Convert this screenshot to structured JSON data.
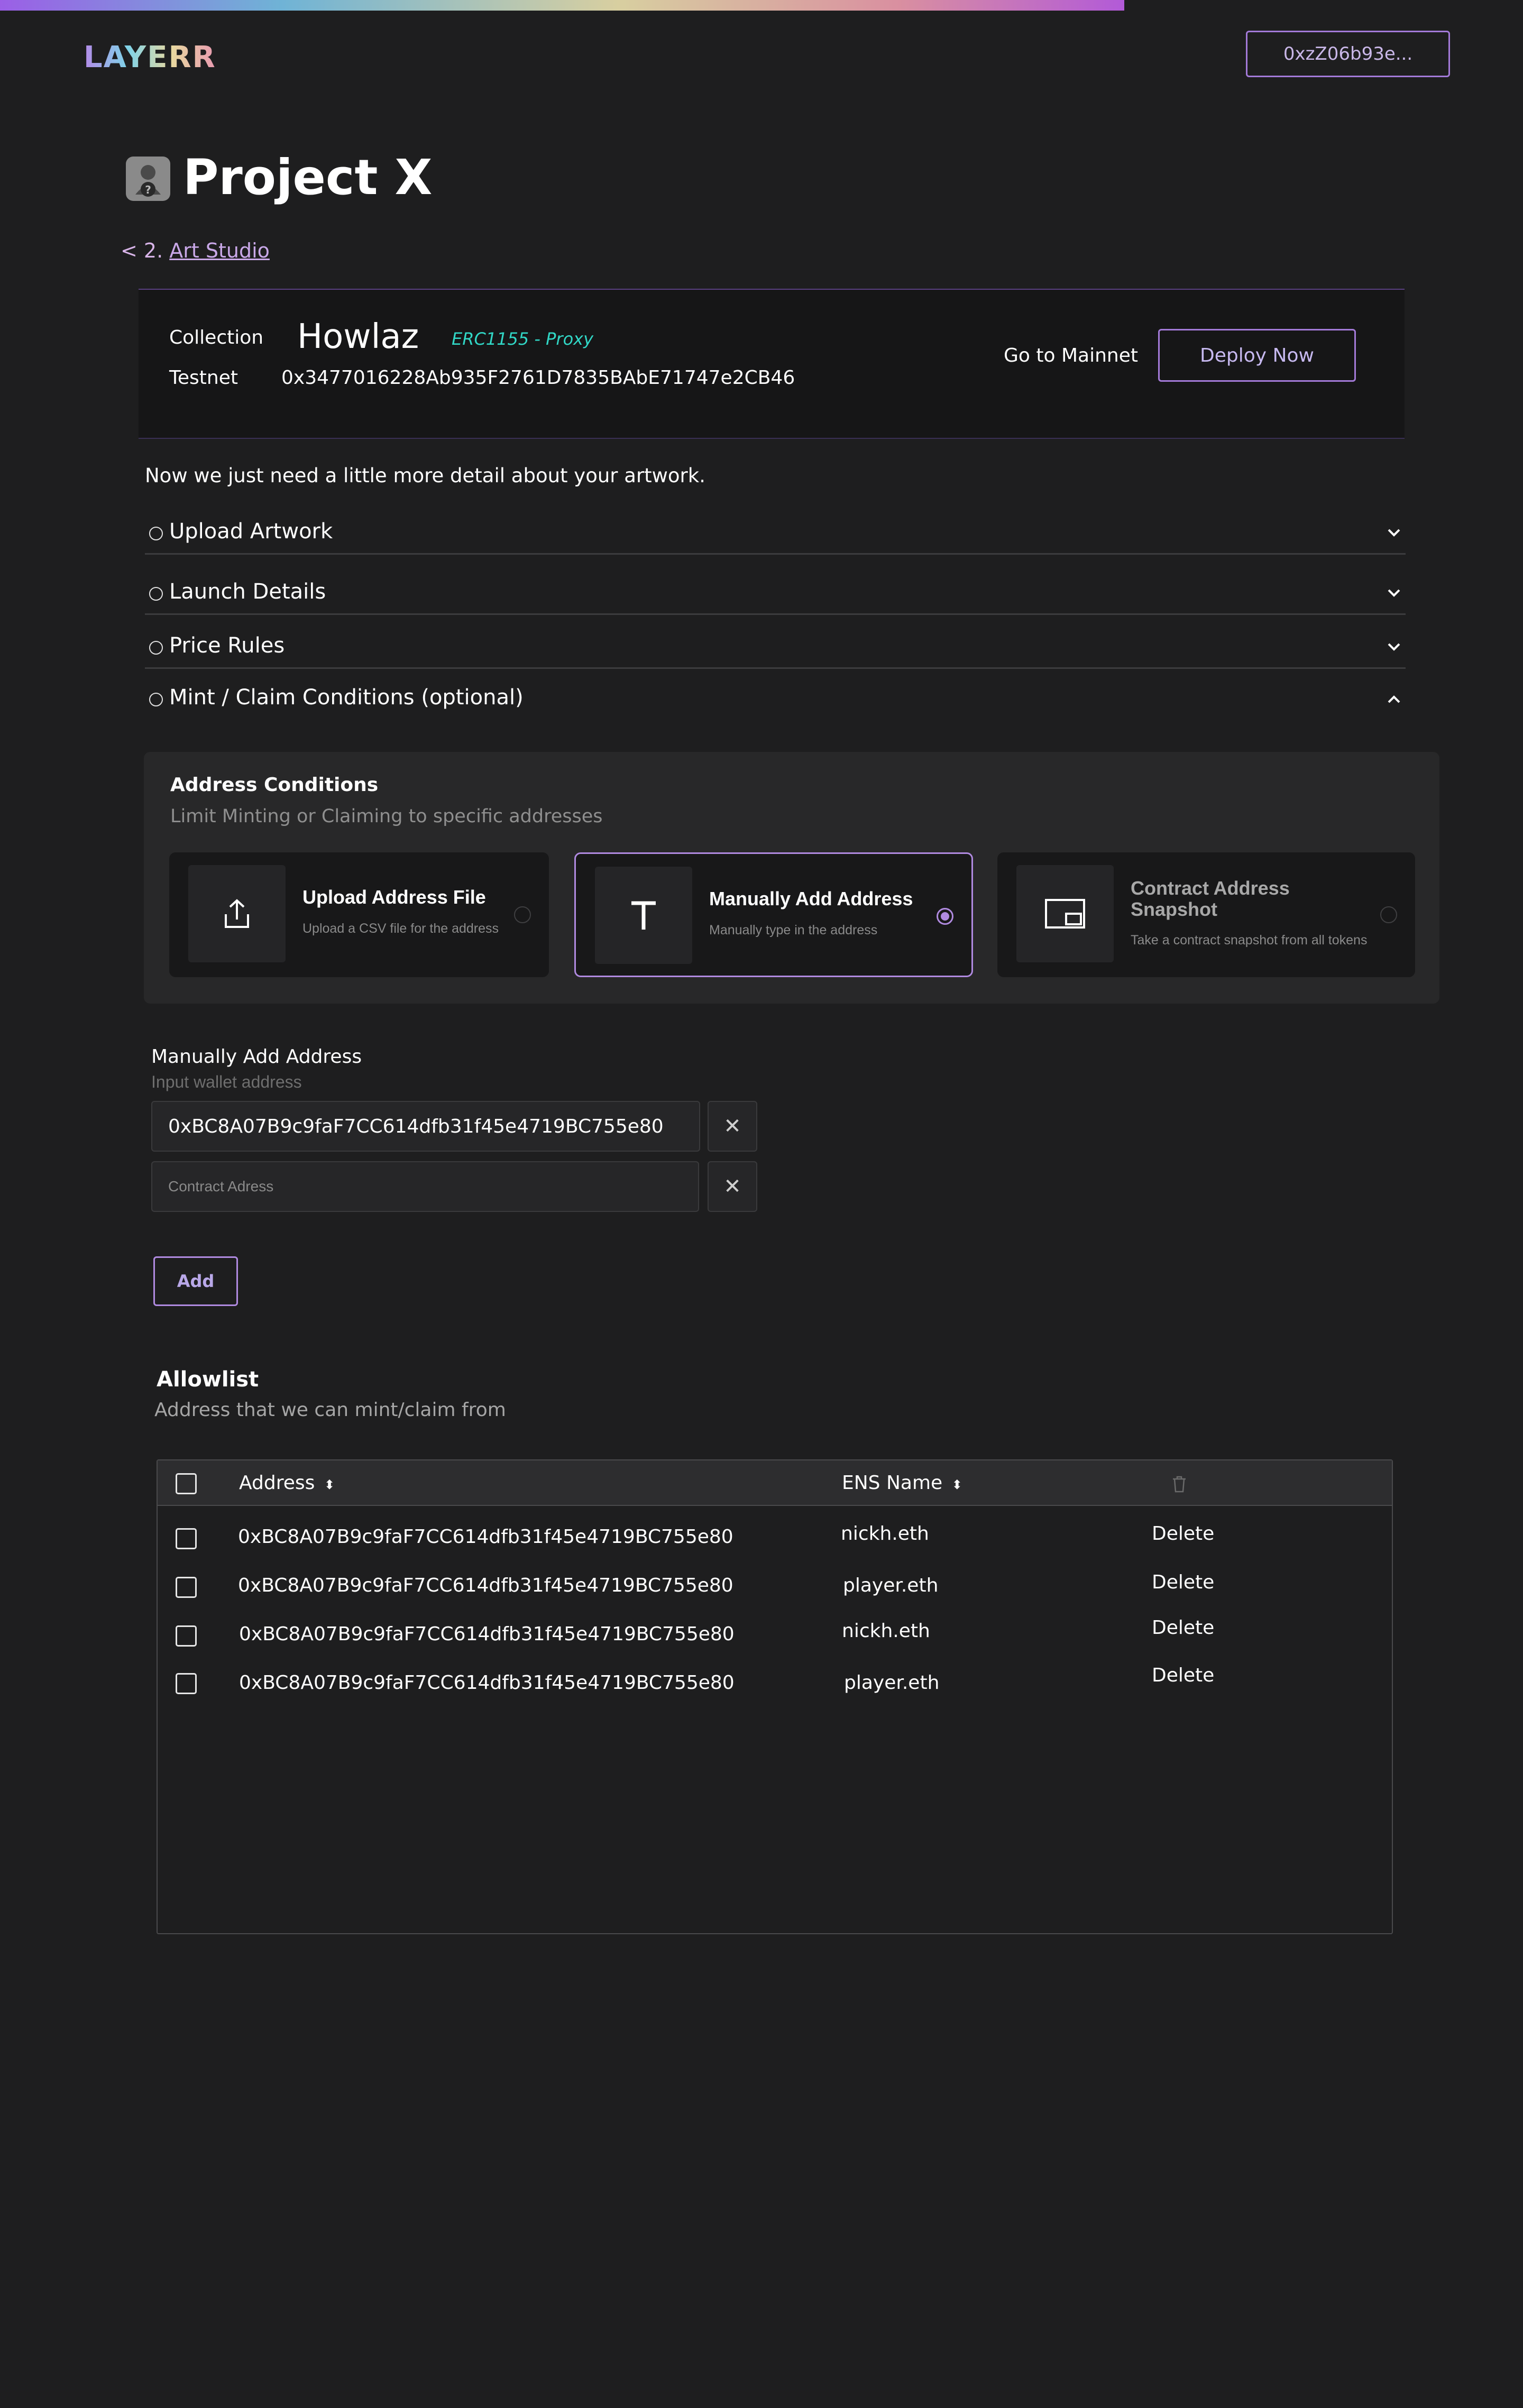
{
  "header": {
    "logo": "LAYERR",
    "wallet": "0xzZ06b93e..."
  },
  "project": {
    "title": "Project X",
    "breadcrumb_prefix": "< 2.",
    "breadcrumb_link": "Art Studio"
  },
  "collection": {
    "collection_label": "Collection",
    "name": "Howlaz",
    "standard": "ERC1155 - Proxy",
    "network_label": "Testnet",
    "address": "0x3477016228Ab935F2761D7835BAbE71747e2CB46",
    "mainnet_link": "Go to Mainnet",
    "deploy_button": "Deploy Now"
  },
  "intro": "Now we just need a little more detail about your artwork.",
  "sections": [
    {
      "label": "Upload Artwork",
      "state": "collapsed"
    },
    {
      "label": "Launch Details",
      "state": "collapsed"
    },
    {
      "label": "Price Rules",
      "state": "collapsed"
    },
    {
      "label": "Mint / Claim Conditions (optional)",
      "state": "expanded"
    }
  ],
  "conditions": {
    "title": "Address Conditions",
    "subtitle": "Limit Minting or Claiming to specific addresses",
    "options": [
      {
        "title": "Upload Address File",
        "desc": "Upload a CSV file for the address",
        "icon": "upload-icon",
        "selected": false
      },
      {
        "title": "Manually Add Address",
        "desc": "Manually type in the address",
        "icon": "text-t-icon",
        "selected": true
      },
      {
        "title": "Contract Address Snapshot",
        "desc": "Take a contract snapshot from all tokens",
        "icon": "snapshot-icon",
        "selected": false
      }
    ]
  },
  "manual": {
    "title": "Manually Add Address",
    "subtitle": "Input wallet address",
    "input_value": "0xBC8A07B9c9faF7CC614dfb31f45e4719BC755e80",
    "placeholder": "Contract Adress",
    "add_button": "Add"
  },
  "allowlist": {
    "title": "Allowlist",
    "subtitle": "Address that we can mint/claim from",
    "columns": {
      "address": "Address",
      "ens": "ENS Name"
    },
    "rows": [
      {
        "address": "0xBC8A07B9c9faF7CC614dfb31f45e4719BC755e80",
        "ens": "nickh.eth",
        "action": "Delete"
      },
      {
        "address": "0xBC8A07B9c9faF7CC614dfb31f45e4719BC755e80",
        "ens": "player.eth",
        "action": "Delete"
      },
      {
        "address": "0xBC8A07B9c9faF7CC614dfb31f45e4719BC755e80",
        "ens": "nickh.eth",
        "action": "Delete"
      },
      {
        "address": "0xBC8A07B9c9faF7CC614dfb31f45e4719BC755e80",
        "ens": "player.eth",
        "action": "Delete"
      }
    ]
  },
  "colors": {
    "accent": "#b08ae0",
    "erc_label": "#31d7c6",
    "background": "#1e1e1f"
  }
}
